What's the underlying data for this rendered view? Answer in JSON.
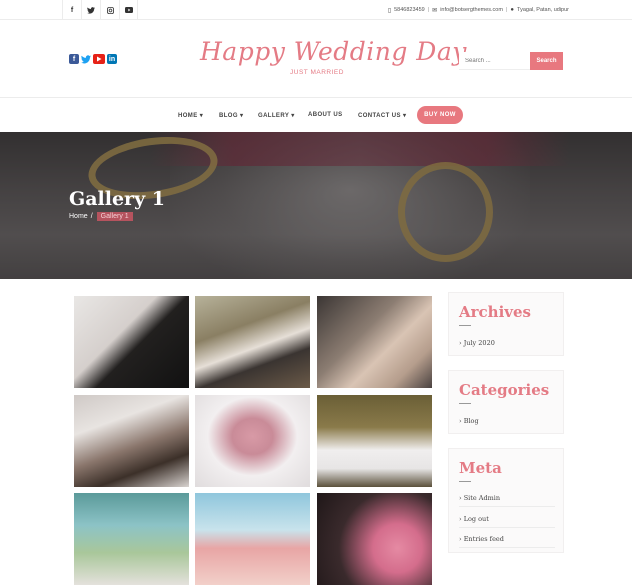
{
  "topbar": {
    "social": [
      {
        "icon": "facebook-icon",
        "glyph": "f"
      },
      {
        "icon": "twitter-icon",
        "glyph": "🐦"
      },
      {
        "icon": "instagram-icon",
        "glyph": "◎"
      },
      {
        "icon": "youtube-icon",
        "glyph": "▶"
      }
    ],
    "phone": "5846823459",
    "email": "info@botsergthemes.com",
    "address": "Tyagal, Patan, udipur"
  },
  "header": {
    "logo_title": "Happy Wedding Day",
    "logo_subtitle": "JUST MARRIED",
    "search_placeholder": "Search ...",
    "search_button": "Search",
    "social": [
      "facebook-icon",
      "twitter-icon",
      "youtube-icon",
      "linkedin-icon"
    ]
  },
  "nav": {
    "items": [
      {
        "label": "HOME",
        "caret": "▾"
      },
      {
        "label": "BLOG",
        "caret": "▾"
      },
      {
        "label": "GALLERY",
        "caret": "▾"
      },
      {
        "label": "ABOUT US",
        "caret": ""
      },
      {
        "label": "CONTACT US",
        "caret": "▾"
      }
    ],
    "cta": "BUY NOW"
  },
  "hero": {
    "title": "Gallery 1",
    "breadcrumb_home": "Home",
    "breadcrumb_sep": "/",
    "breadcrumb_current": "Gallery 1"
  },
  "gallery": {
    "images": [
      "bride-bouquet-photo",
      "couple-floral-arch-photo",
      "rings-in-hand-photo",
      "couple-veil-kiss-photo",
      "rings-on-pillow-photo",
      "bride-sitting-photo",
      "outdoor-ceremony-photo",
      "beach-ceremony-photo",
      "pink-flowers-photo"
    ]
  },
  "sidebar": {
    "archives": {
      "title": "Archives",
      "links": [
        "July 2020"
      ]
    },
    "categories": {
      "title": "Categories",
      "links": [
        "Blog"
      ]
    },
    "meta": {
      "title": "Meta",
      "links": [
        "Site Admin",
        "Log out",
        "Entries feed"
      ]
    },
    "link_prefix": "›"
  },
  "colors": {
    "accent": "#e8787f",
    "logo": "#e47b85",
    "breadcrumb_active_bg": "#b5535e"
  }
}
